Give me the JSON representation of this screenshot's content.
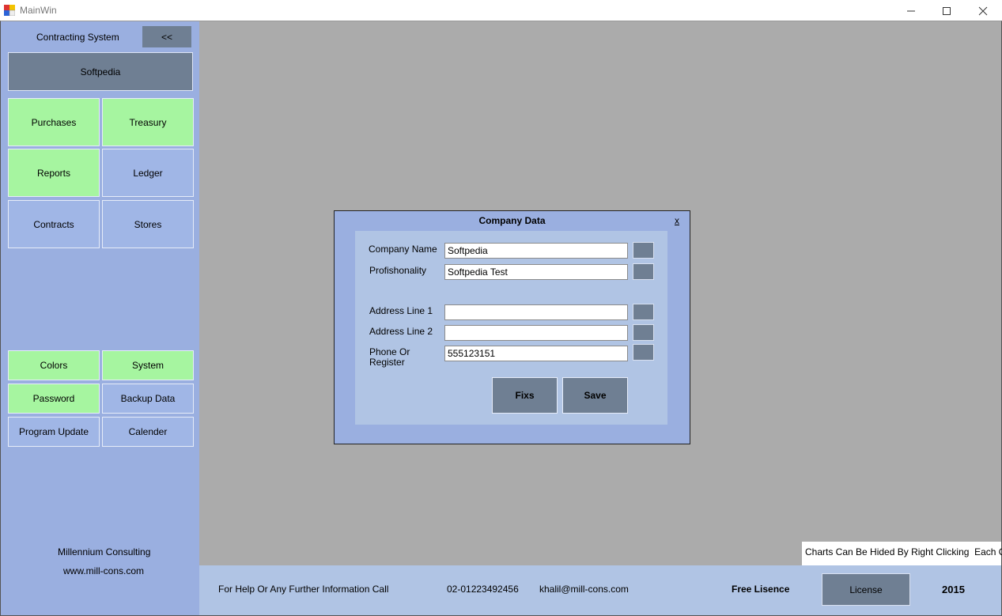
{
  "window": {
    "title": "MainWin",
    "controls": [
      "—",
      "☐",
      "✕"
    ]
  },
  "sidebar": {
    "title": "Contracting System",
    "collapse_label": "<<",
    "company_label": "Softpedia",
    "tiles_top": [
      "Purchases",
      "Treasury",
      "Reports",
      "Ledger",
      "Contracts",
      "Stores"
    ],
    "tiles_bottom": [
      "Colors",
      "System",
      "Password",
      "Backup Data",
      "Program Update",
      "Calender"
    ],
    "footer_company": "Millennium Consulting",
    "footer_url": "www.mill-cons.com"
  },
  "main": {
    "charts_hint": "Charts Can Be Hided By Right Clicking  Each One"
  },
  "bottombar": {
    "help_text": "For Help Or Any Further Information Call",
    "phone": "02-01223492456",
    "email": "khalil@mill-cons.com",
    "free_license": "Free Lisence",
    "license_button": "License",
    "year": "2015"
  },
  "dialog": {
    "title": "Company Data",
    "close": "x",
    "fields": [
      {
        "label": "Company Name",
        "value": "Softpedia"
      },
      {
        "label": "Profishonality",
        "value": "Softpedia Test"
      },
      {
        "label": "Address Line 1",
        "value": ""
      },
      {
        "label": "Address Line 2",
        "value": ""
      },
      {
        "label": "Phone Or Register",
        "value": "555123151"
      }
    ],
    "fix_button": "Fixs",
    "save_button": "Save"
  },
  "colors": {
    "sidebar_bg": "#9aafe0",
    "tile_green": "#a6f5a0",
    "tile_blue": "#a0b6e6",
    "button_gray": "#6f7f93",
    "main_bg": "#ababab"
  }
}
